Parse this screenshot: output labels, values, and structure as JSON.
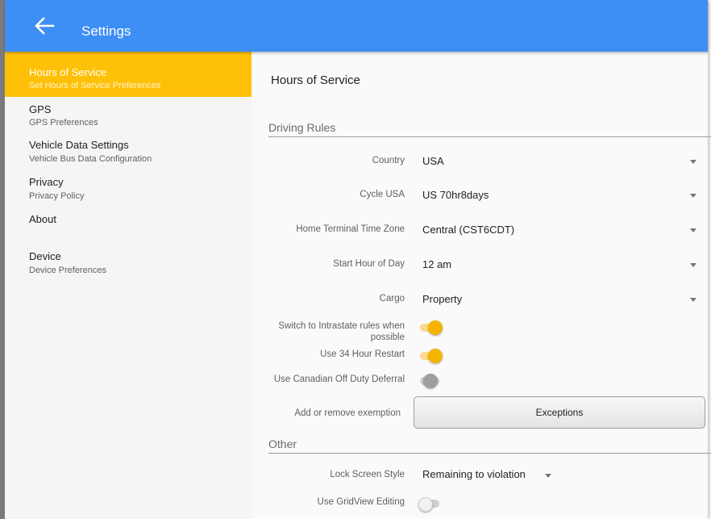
{
  "appbar": {
    "title": "Settings",
    "back_icon": "arrow-back-icon"
  },
  "sidebar": {
    "items": [
      {
        "title": "Hours of Service",
        "subtitle": "Set Hours of Service Preferences",
        "active": true
      },
      {
        "title": "GPS",
        "subtitle": "GPS Preferences"
      },
      {
        "title": "Vehicle Data Settings",
        "subtitle": "Vehicle Bus Data Configuration"
      },
      {
        "title": "Privacy",
        "subtitle": "Privacy Policy"
      },
      {
        "title": "About",
        "subtitle": ""
      },
      {
        "title": "Device",
        "subtitle": "Device Preferences"
      }
    ]
  },
  "main": {
    "title": "Hours of Service",
    "driving_rules": {
      "heading": "Driving Rules",
      "country": {
        "label": "Country",
        "value": "USA"
      },
      "cycle": {
        "label": "Cycle USA",
        "value": "US 70hr8days"
      },
      "timezone": {
        "label": "Home Terminal Time Zone",
        "value": "Central (CST6CDT)"
      },
      "start_hour": {
        "label": "Start Hour of Day",
        "value": "12 am"
      },
      "cargo": {
        "label": "Cargo",
        "value": "Property"
      },
      "intrastate": {
        "label_line1": "Switch to Intrastate rules when",
        "label_line2": "possible",
        "on": true
      },
      "restart34": {
        "label": "Use 34 Hour Restart",
        "on": true
      },
      "canadian_deferral": {
        "label": "Use Canadian Off Duty Deferral",
        "on": false
      },
      "exemption": {
        "label": "Add or remove exemption",
        "button": "Exceptions"
      }
    },
    "other": {
      "heading": "Other",
      "lock_screen": {
        "label": "Lock Screen Style",
        "value": "Remaining to violation"
      },
      "gridview": {
        "label": "Use GridView Editing",
        "on": false
      }
    }
  },
  "colors": {
    "appbar": "#3d8ef5",
    "accent": "#ffc107",
    "toggle_on": "#f5b400"
  }
}
